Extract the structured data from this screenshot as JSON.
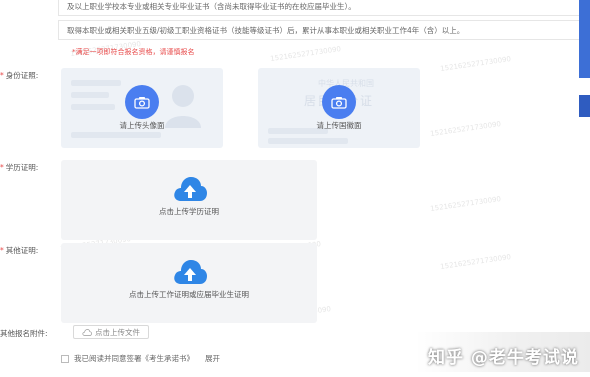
{
  "conditions": {
    "line1": "及以上职业学校本专业或相关专业毕业证书（含尚未取得毕业证书的在校应届毕业生）。",
    "line2": "取得本职业或相关职业五级/初级工职业资格证书（技能等级证书）后，累计从事本职业或相关职业工作4年（含）以上。"
  },
  "hint": "*满足一项即符合报名资格，请谨慎报名",
  "id_card": {
    "label": "身份证照:",
    "front_caption": "请上传头像面",
    "back_caption": "请上传国徽面",
    "back_ghost_title": "中华人民共和国",
    "back_ghost_subtitle": "居民身份证"
  },
  "education": {
    "label": "学历证明:",
    "caption": "点击上传学历证明"
  },
  "other": {
    "label": "其他证明:",
    "caption": "点击上传工作证明或应届毕业生证明"
  },
  "attachments": {
    "label": "其他报名附件:",
    "button": "点击上传文件"
  },
  "agreement": {
    "text": "我已阅读并同意签署《考生承诺书》",
    "expand": "展开"
  },
  "watermark": "1521625271730090",
  "brand": "知乎 @老牛考试说",
  "colors": {
    "accent": "#4a7ef0",
    "required": "#e84a4a",
    "side_tab": "#3d6fd6"
  }
}
